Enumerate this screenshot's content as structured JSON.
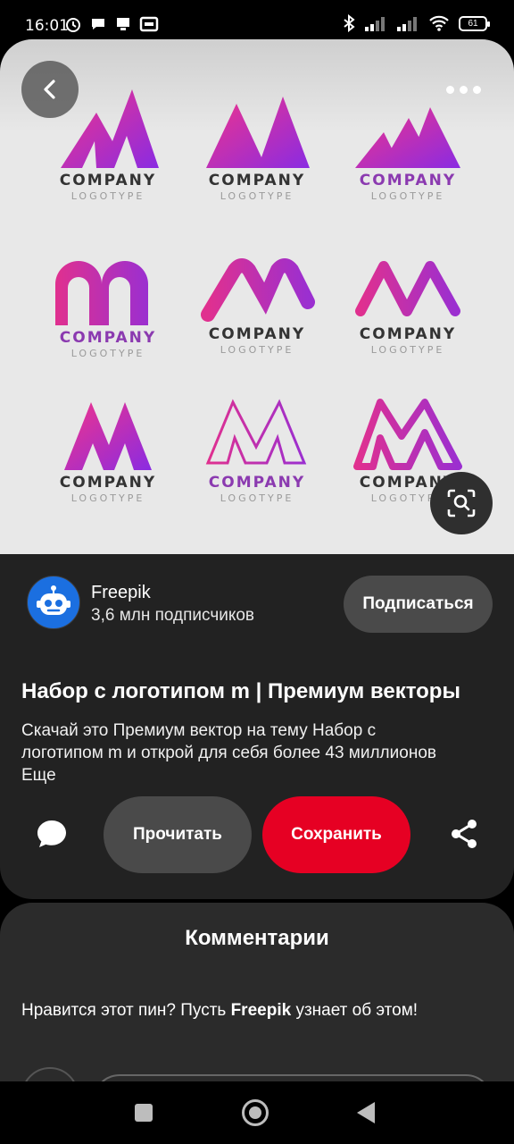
{
  "status_bar": {
    "time": "16:01",
    "battery": "61"
  },
  "logos": [
    {
      "company": "COMPANY",
      "tagline": "LOGOTYPE"
    },
    {
      "company": "COMPANY",
      "tagline": "LOGOTYPE"
    },
    {
      "company": "COMPANY",
      "tagline": "LOGOTYPE"
    },
    {
      "company": "COMPANY",
      "tagline": "LOGOTYPE"
    },
    {
      "company": "COMPANY",
      "tagline": "LOGOTYPE"
    },
    {
      "company": "COMPANY",
      "tagline": "LOGOTYPE"
    },
    {
      "company": "COMPANY",
      "tagline": "LOGOTYPE"
    },
    {
      "company": "COMPANY",
      "tagline": "LOGOTYPE"
    },
    {
      "company": "COMPANY",
      "tagline": "LOGOTYPE"
    }
  ],
  "author": {
    "name": "Freepik",
    "subscribers": "3,6 млн подписчиков",
    "subscribe_label": "Подписаться"
  },
  "pin": {
    "title": "Набор с логотипом m | Премиум векторы",
    "description_line1": "Скачай это Премиум вектор на тему Набор с",
    "description_line2": "логотипом m и открой для себя более 43 миллионов",
    "more_label": "Еще"
  },
  "actions": {
    "read_label": "Прочитать",
    "save_label": "Сохранить"
  },
  "comments": {
    "title": "Комментарии",
    "prompt_before": "Нравится этот пин? Пусть ",
    "prompt_author": "Freepik",
    "prompt_after": " узнает об этом!"
  },
  "colors": {
    "save": "#e60023",
    "accent_gradient": [
      "#e0388a",
      "#8a2be2"
    ],
    "avatar": "#1b6fe0"
  }
}
